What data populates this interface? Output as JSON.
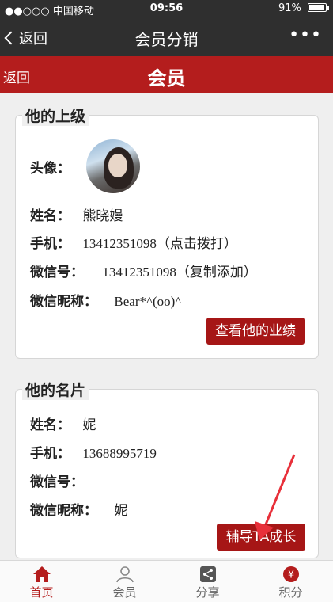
{
  "status_bar": {
    "carrier": "●●○○○ 中国移动",
    "time": "09:56",
    "battery": "91%"
  },
  "wechat_nav": {
    "back_label": "返回",
    "title": "会员分销",
    "more_label": "•••"
  },
  "header": {
    "back_label": "返回",
    "title": "会员"
  },
  "superior": {
    "legend": "他的上级",
    "avatar_label": "头像：",
    "name_label": "姓名：",
    "name_value": "熊晓嫚",
    "phone_label": "手机：",
    "phone_value": "13412351098（点击拨打）",
    "wechat_label": "微信号：",
    "wechat_value": "13412351098（复制添加）",
    "nickname_label": "微信昵称：",
    "nickname_value": "Bear*^(oo)^",
    "button_label": "查看他的业绩"
  },
  "card": {
    "legend": "他的名片",
    "name_label": "姓名：",
    "name_value": "妮",
    "phone_label": "手机：",
    "phone_value": "13688995719",
    "wechat_label": "微信号：",
    "wechat_value": "",
    "nickname_label": "微信昵称：",
    "nickname_value": "妮",
    "button_label": "辅导TA成长"
  },
  "tabs": [
    {
      "label": "首页",
      "icon": "home-icon",
      "active": true
    },
    {
      "label": "会员",
      "icon": "user-icon",
      "active": false
    },
    {
      "label": "分享",
      "icon": "share-icon",
      "active": false
    },
    {
      "label": "积分",
      "icon": "yen-icon",
      "active": false
    }
  ],
  "colors": {
    "accent": "#b41d1d",
    "nav": "#2f2f2f",
    "button": "#a61616"
  }
}
